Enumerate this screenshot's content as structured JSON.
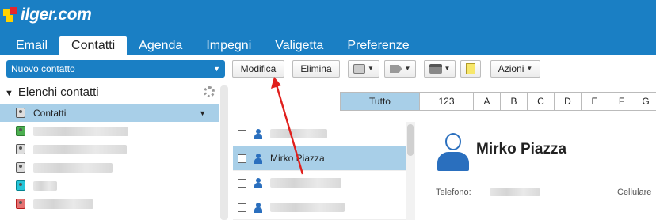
{
  "app": {
    "logo_text": "ilger.com"
  },
  "nav_tabs": [
    {
      "label": "Email",
      "active": false
    },
    {
      "label": "Contatti",
      "active": true
    },
    {
      "label": "Agenda",
      "active": false
    },
    {
      "label": "Impegni",
      "active": false
    },
    {
      "label": "Valigetta",
      "active": false
    },
    {
      "label": "Preferenze",
      "active": false
    }
  ],
  "toolbar": {
    "new_contact_label": "Nuovo contatto",
    "edit_label": "Modifica",
    "delete_label": "Elimina",
    "actions_label": "Azioni"
  },
  "sidebar": {
    "title": "Elenchi contatti",
    "active_list": "Contatti",
    "lists": [
      {
        "label": "Contatti",
        "icon": "address-book-icon",
        "active": true
      },
      {
        "label": "",
        "icon": "address-book-icon"
      },
      {
        "label": "",
        "icon": "address-book-icon"
      },
      {
        "label": "",
        "icon": "address-book-icon"
      },
      {
        "label": "",
        "icon": "address-book-icon"
      },
      {
        "label": "",
        "icon": "address-book-icon"
      }
    ]
  },
  "alpha_filter": [
    "Tutto",
    "123",
    "A",
    "B",
    "C",
    "D",
    "E",
    "F",
    "G"
  ],
  "contacts": [
    {
      "name": "",
      "selected": false
    },
    {
      "name": "Mirko Piazza",
      "selected": true
    },
    {
      "name": "",
      "selected": false
    },
    {
      "name": "",
      "selected": false
    }
  ],
  "detail": {
    "name": "Mirko Piazza",
    "phone_label": "Telefono:",
    "mobile_label": "Cellulare"
  },
  "colors": {
    "brand": "#1a7fc4",
    "selection": "#a8cfe8",
    "annotation_arrow": "#e0201d"
  }
}
